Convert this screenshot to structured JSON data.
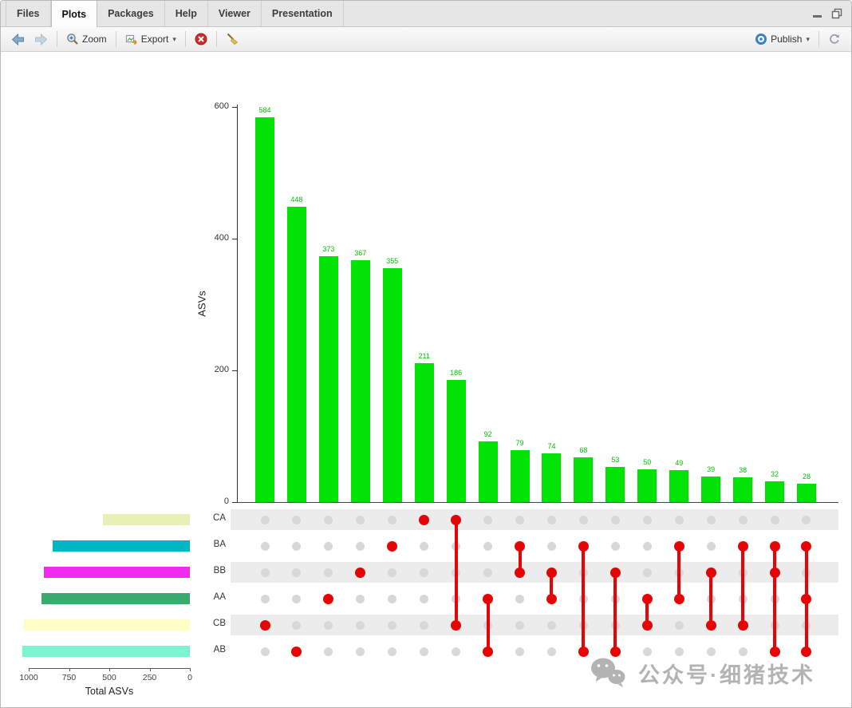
{
  "tabs": [
    {
      "label": "Files"
    },
    {
      "label": "Plots"
    },
    {
      "label": "Packages"
    },
    {
      "label": "Help"
    },
    {
      "label": "Viewer"
    },
    {
      "label": "Presentation"
    }
  ],
  "active_tab": "Plots",
  "toolbar": {
    "zoom": "Zoom",
    "export": "Export",
    "publish": "Publish"
  },
  "watermark": "公众号·细猪技术",
  "chart_data": {
    "type": "bar",
    "subtype": "upset-plot",
    "title": "",
    "ylabel": "ASVs",
    "y_ticks": [
      0,
      200,
      400,
      600
    ],
    "ylim": [
      0,
      650
    ],
    "bar_color": "#00e205",
    "label_color": "#00c400",
    "dot_color_inactive": "#d8d8d8",
    "dot_color_active": "#e60404",
    "stripe_color": "#ececec",
    "sets": [
      {
        "name": "CA",
        "total": 540,
        "color": "#e9efb5"
      },
      {
        "name": "BA",
        "total": 850,
        "color": "#00b5c4"
      },
      {
        "name": "BB",
        "total": 905,
        "color": "#ee2bee"
      },
      {
        "name": "AA",
        "total": 920,
        "color": "#3aaa6e"
      },
      {
        "name": "CB",
        "total": 1030,
        "color": "#ffffc5"
      },
      {
        "name": "AB",
        "total": 1040,
        "color": "#7cf5cf"
      }
    ],
    "totals_axis": {
      "label": "Total ASVs",
      "ticks": [
        1000,
        750,
        500,
        250,
        0
      ],
      "max": 1000
    },
    "intersections": [
      {
        "value": 584,
        "sets": [
          "CB"
        ]
      },
      {
        "value": 448,
        "sets": [
          "AB"
        ]
      },
      {
        "value": 373,
        "sets": [
          "AA"
        ]
      },
      {
        "value": 367,
        "sets": [
          "BB"
        ]
      },
      {
        "value": 355,
        "sets": [
          "BA"
        ]
      },
      {
        "value": 211,
        "sets": [
          "CA"
        ]
      },
      {
        "value": 186,
        "sets": [
          "CA",
          "CB"
        ]
      },
      {
        "value": 92,
        "sets": [
          "AA",
          "AB"
        ]
      },
      {
        "value": 79,
        "sets": [
          "BA",
          "BB"
        ]
      },
      {
        "value": 74,
        "sets": [
          "BB",
          "AA"
        ]
      },
      {
        "value": 68,
        "sets": [
          "BA",
          "AB"
        ]
      },
      {
        "value": 53,
        "sets": [
          "BB",
          "AB"
        ]
      },
      {
        "value": 50,
        "sets": [
          "AA",
          "CB"
        ]
      },
      {
        "value": 49,
        "sets": [
          "BA",
          "AA"
        ]
      },
      {
        "value": 39,
        "sets": [
          "BB",
          "CB"
        ]
      },
      {
        "value": 38,
        "sets": [
          "BA",
          "CB"
        ]
      },
      {
        "value": 32,
        "sets": [
          "BA",
          "BB",
          "AB"
        ]
      },
      {
        "value": 28,
        "sets": [
          "BA",
          "AA",
          "AB"
        ]
      }
    ]
  }
}
